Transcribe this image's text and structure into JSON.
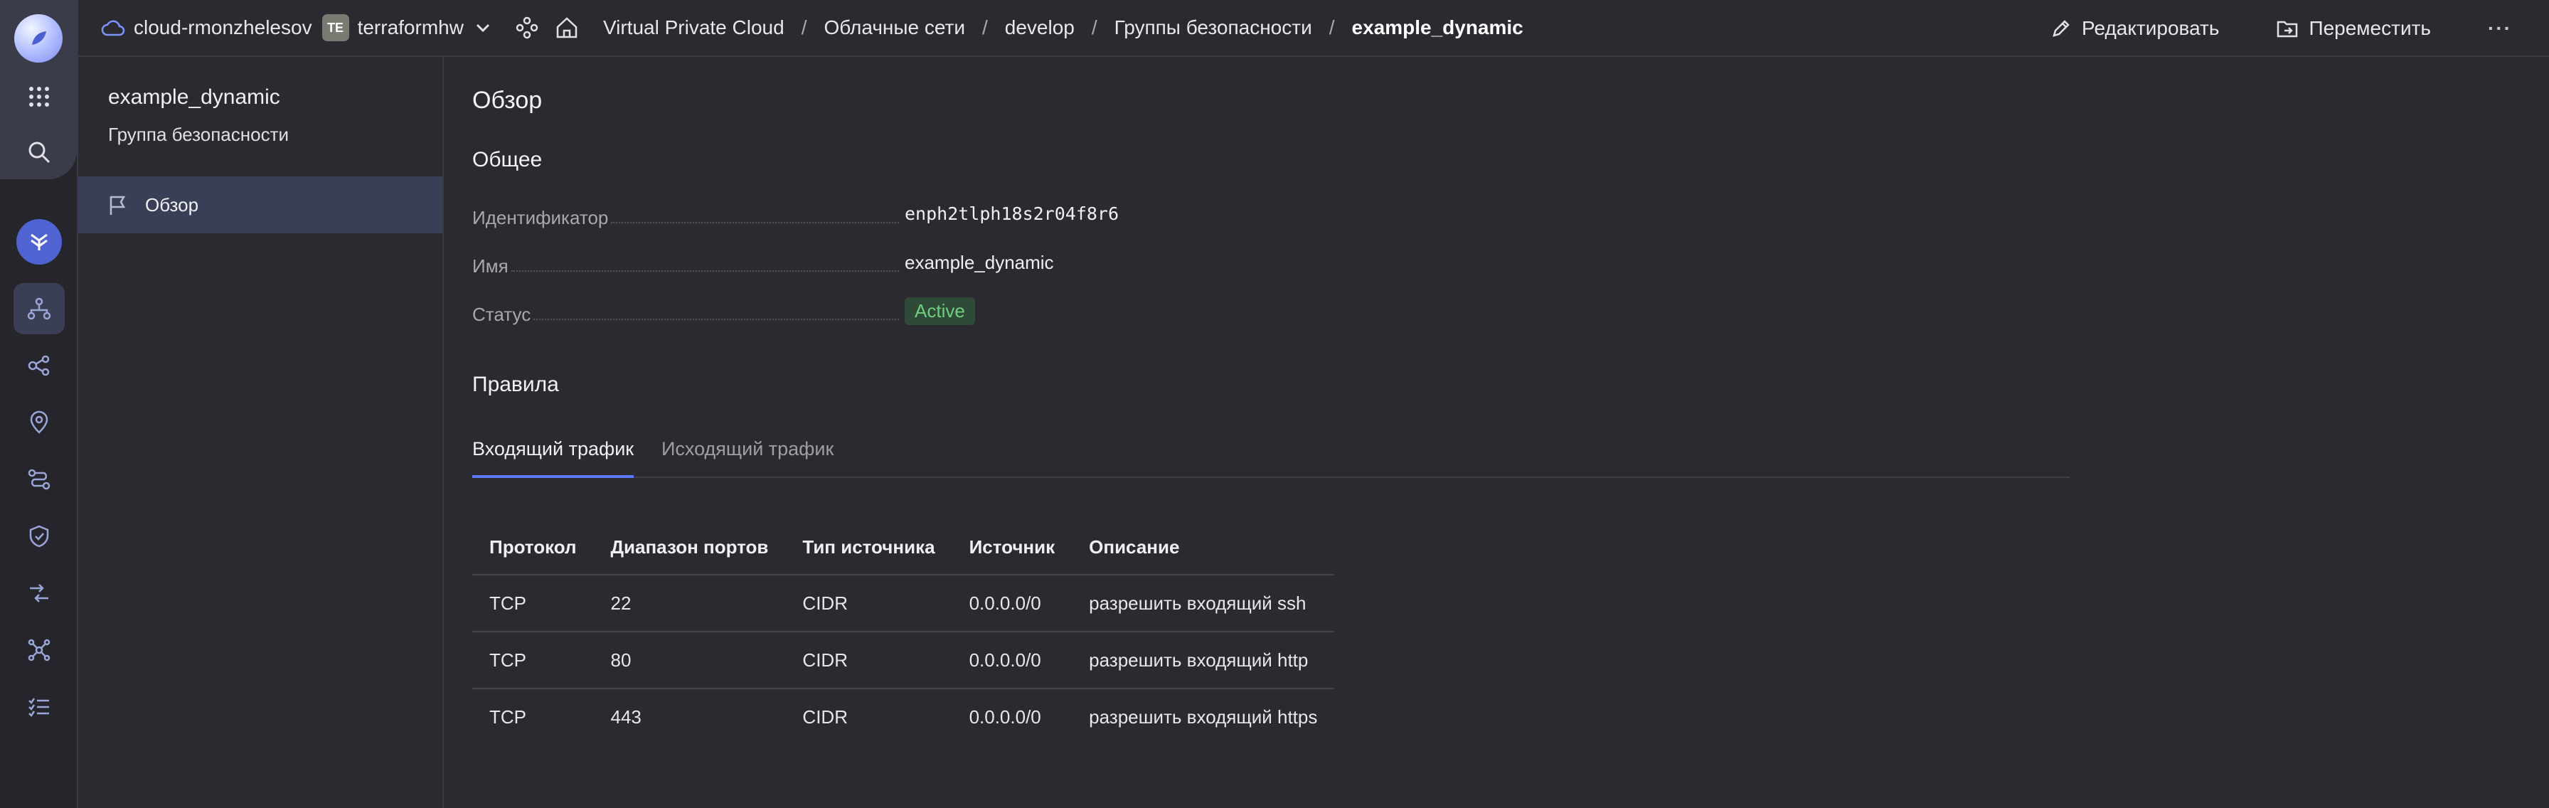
{
  "header": {
    "cloud_name": "cloud-rmonzhelesov",
    "folder_badge": "TE",
    "folder_name": "terraformhw",
    "breadcrumbs": [
      "Virtual Private Cloud",
      "Облачные сети",
      "develop",
      "Группы безопасности",
      "example_dynamic"
    ],
    "edit_label": "Редактировать",
    "move_label": "Переместить",
    "more_label": "···"
  },
  "sidebar": {
    "title": "example_dynamic",
    "subtitle": "Группа безопасности",
    "items": [
      {
        "label": "Обзор",
        "icon": "flag-icon"
      }
    ]
  },
  "main": {
    "heading": "Обзор",
    "general_heading": "Общее",
    "properties": [
      {
        "label": "Идентификатор",
        "value": "enph2tlph18s2r04f8r6"
      },
      {
        "label": "Имя",
        "value": "example_dynamic"
      },
      {
        "label": "Статус",
        "value": "Active"
      }
    ],
    "rules_heading": "Правила",
    "tabs": [
      "Входящий трафик",
      "Исходящий трафик"
    ],
    "active_tab": "Входящий трафик",
    "table": {
      "columns": [
        "Протокол",
        "Диапазон портов",
        "Тип источника",
        "Источник",
        "Описание"
      ],
      "rows": [
        [
          "TCP",
          "22",
          "CIDR",
          "0.0.0.0/0",
          "разрешить входящий ssh"
        ],
        [
          "TCP",
          "80",
          "CIDR",
          "0.0.0.0/0",
          "разрешить входящий http"
        ],
        [
          "TCP",
          "443",
          "CIDR",
          "0.0.0.0/0",
          "разрешить входящий https"
        ]
      ]
    }
  },
  "colors": {
    "accent": "#5b77ff",
    "status_active_bg": "#2f4a36",
    "status_active_text": "#6fcf7f",
    "sidebar_active_bg": "#3a3f58"
  }
}
